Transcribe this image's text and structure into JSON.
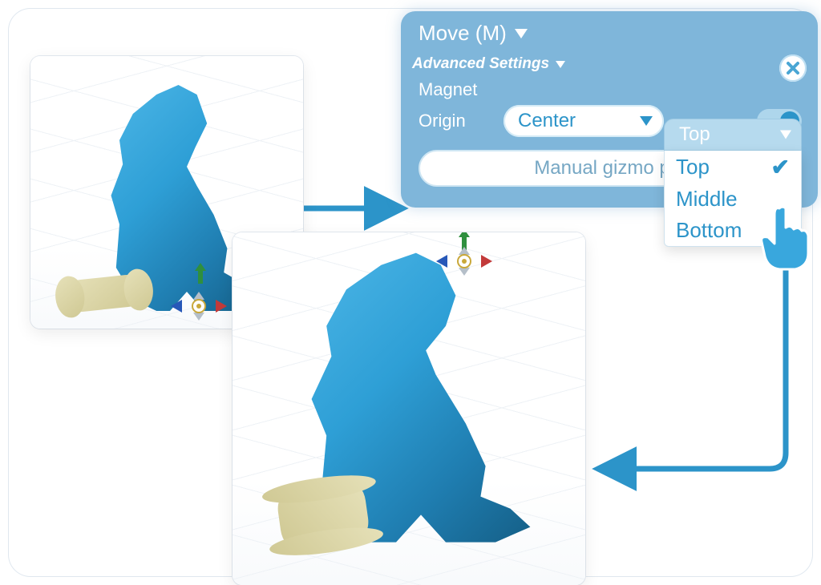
{
  "panel": {
    "title": "Move (M)",
    "subsection": "Advanced Settings",
    "magnet_label": "Magnet",
    "origin_label": "Origin",
    "origin_select_value": "Center",
    "vertical_select_value": "Top",
    "vertical_options": [
      "Top",
      "Middle",
      "Bottom"
    ],
    "vertical_selected_index": 0,
    "manual_button": "Manual gizmo p",
    "magnet_on": true
  },
  "colors": {
    "panel_bg": "#7fb6da",
    "accent": "#2c94c9",
    "model": "#39a7dd"
  },
  "icons": {
    "close": "close-icon",
    "caret": "chevron-down-icon",
    "hand": "pointer-hand-icon",
    "gizmo": "move-gizmo-icon",
    "up": "up-arrow-icon"
  }
}
